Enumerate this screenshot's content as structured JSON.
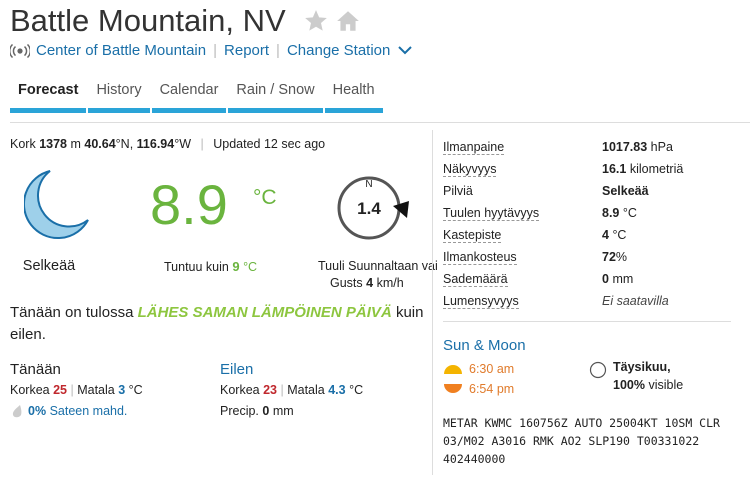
{
  "header": {
    "title": "Battle Mountain, NV",
    "links": {
      "center": "Center of Battle Mountain",
      "report": "Report",
      "change_station": "Change Station"
    }
  },
  "tabs": [
    {
      "label": "Forecast",
      "active": true
    },
    {
      "label": "History"
    },
    {
      "label": "Calendar"
    },
    {
      "label": "Rain / Snow"
    },
    {
      "label": "Health"
    }
  ],
  "station": {
    "elev_label": "Kork",
    "elev": "1378",
    "elev_unit": "m",
    "lat": "40.64",
    "lat_dir": "°N,",
    "lon": "116.94",
    "lon_dir": "°W",
    "updated_label": "Updated",
    "updated_value": "12 sec ago"
  },
  "current": {
    "condition": "Selkeää",
    "icon": "moon-icon",
    "temp": "8.9",
    "temp_unit": "°C",
    "feels_label": "Tuntuu kuin",
    "feels_value": "9",
    "feels_unit": "°C",
    "wind_dir": "N",
    "wind_speed": "1.4",
    "wind_label": "Tuuli Suunnaltaan vai",
    "gusts_label": "Gusts",
    "gusts_value": "4",
    "gusts_unit": "km/h"
  },
  "summary": {
    "pre": "Tänään on tulossa",
    "highlight": "LÄHES SAMAN LÄMPÖINEN PÄIVÄ",
    "post": "kuin eilen."
  },
  "today": {
    "heading": "Tänään",
    "high_label": "Korkea",
    "high": "25",
    "low_label": "Matala",
    "low": "3",
    "unit": "°C",
    "precip_value": "0%",
    "precip_label": "Sateen mahd."
  },
  "yesterday": {
    "heading": "Eilen",
    "high_label": "Korkea",
    "high": "23",
    "low_label": "Matala",
    "low": "4.3",
    "unit": "°C",
    "precip_label": "Precip.",
    "precip_value": "0",
    "precip_unit": "mm"
  },
  "conditions": [
    {
      "label": "Ilmanpaine",
      "value": "1017.83",
      "unit": "hPa"
    },
    {
      "label": "Näkyvyys",
      "value": "16.1",
      "unit": "kilometriä"
    },
    {
      "label": "Pilviä",
      "value": "Selkeää",
      "unit": ""
    },
    {
      "label": "Tuulen hyytävyys",
      "value": "8.9",
      "unit": "°C"
    },
    {
      "label": "Kastepiste",
      "value": "4",
      "unit": "°C"
    },
    {
      "label": "Ilmankosteus",
      "value": "72",
      "unit": "%"
    },
    {
      "label": "Sademäärä",
      "value": "0",
      "unit": "mm"
    },
    {
      "label": "Lumensyvyys",
      "value": "",
      "unit": "Ei saatavilla"
    }
  ],
  "sun_moon": {
    "heading": "Sun & Moon",
    "sunrise": "6:30",
    "sunrise_ampm": "am",
    "sunset": "6:54",
    "sunset_ampm": "pm",
    "moon_phase": "Täysikuu,",
    "moon_visible": "100%",
    "moon_visible_label": "visible"
  },
  "metar": "METAR KWMC 160756Z AUTO 25004KT 10SM CLR 03/M02 A3016 RMK AO2 SLP190 T00331022 402440000",
  "colors": {
    "accent": "#2aa4d8",
    "link": "#1a6fa8",
    "temp": "#6ab43e",
    "highlight": "#8dc63f",
    "high": "#c0282d"
  }
}
